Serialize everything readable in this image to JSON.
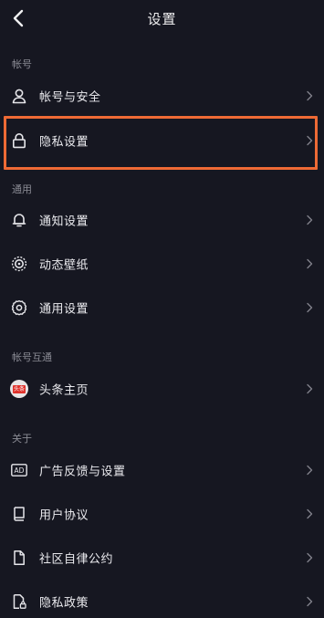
{
  "header": {
    "title": "设置"
  },
  "sections": {
    "account": "帐号",
    "general": "通用",
    "interop": "帐号互通",
    "about": "关于"
  },
  "items": {
    "account_security": "帐号与安全",
    "privacy_settings": "隐私设置",
    "notification_settings": "通知设置",
    "live_wallpaper": "动态壁纸",
    "general_settings": "通用设置",
    "toutiao_home": "头条主页",
    "ad_feedback": "广告反馈与设置",
    "user_agreement": "用户协议",
    "community_rules": "社区自律公约",
    "privacy_policy": "隐私政策"
  },
  "icons": {
    "toutiao_badge": "头条",
    "ad_badge": "AD"
  },
  "colors": {
    "background": "#161721",
    "highlight": "#ee6a35",
    "text": "#ebebef",
    "muted": "#8a8b94"
  }
}
